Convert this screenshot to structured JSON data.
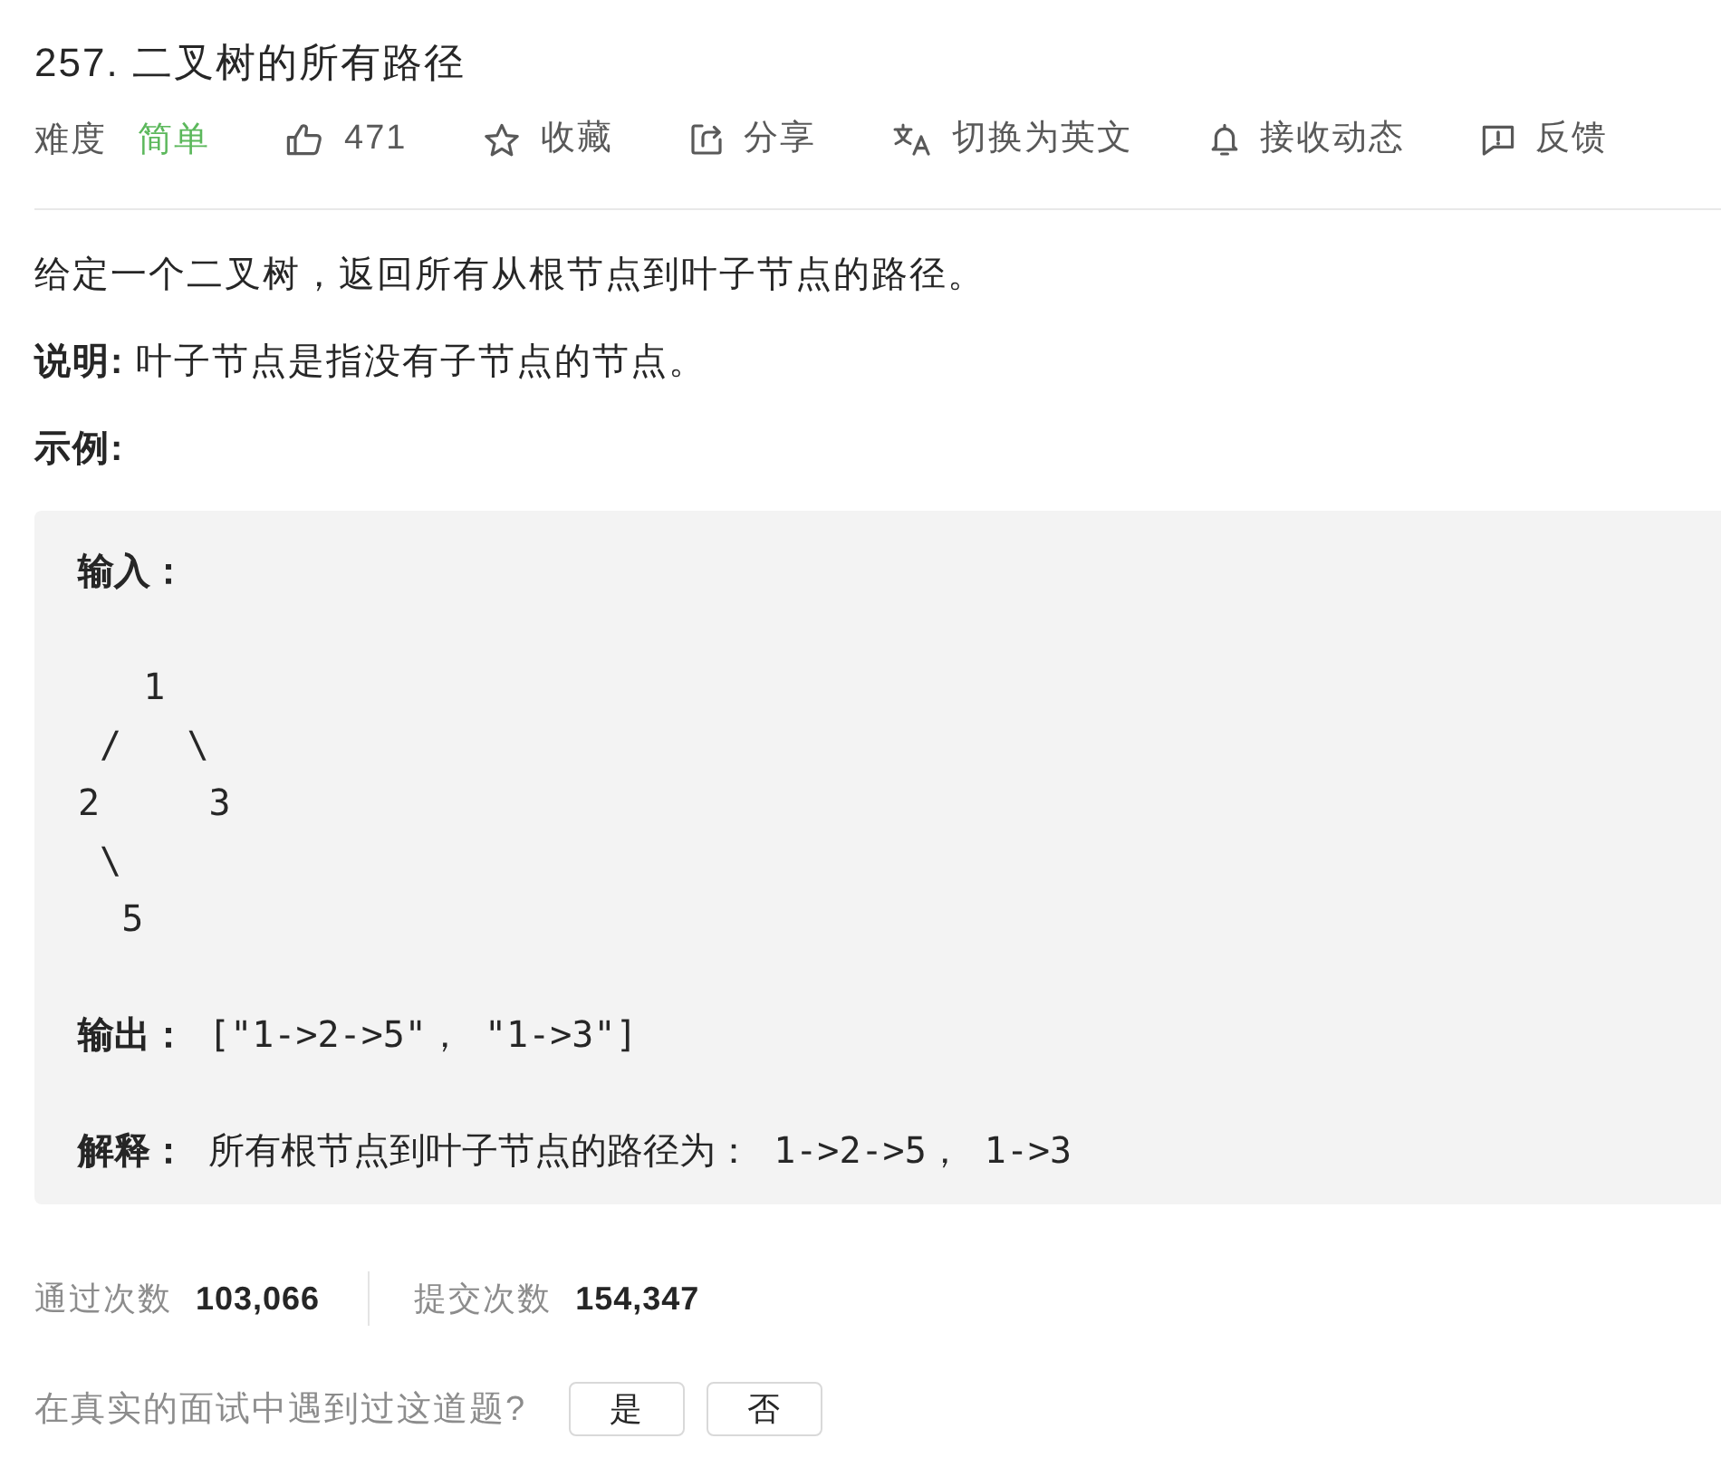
{
  "problem": {
    "title": "257. 二叉树的所有路径"
  },
  "toolbar": {
    "difficulty_label": "难度",
    "difficulty": "简单",
    "actions": [
      {
        "kind": "like",
        "label": "471"
      },
      {
        "kind": "favorite",
        "label": "收藏"
      },
      {
        "kind": "share",
        "label": "分享"
      },
      {
        "kind": "translate",
        "label": "切换为英文"
      },
      {
        "kind": "notify",
        "label": "接收动态"
      },
      {
        "kind": "feedback",
        "label": "反馈"
      }
    ]
  },
  "description": {
    "paragraphs": [
      "给定一个二叉树，返回所有从根节点到叶子节点的路径。",
      "**说明:** 叶子节点是指没有子节点的节点。"
    ],
    "example_heading": "示例:"
  },
  "example": {
    "input_label": "输入：",
    "tree": "   1\n /   \\\n2     3\n \\\n  5",
    "output": "**输出：** [\"1->2->5\"， \"1->3\"]",
    "explanation": "**解释：** 所有根节点到叶子节点的路径为： 1->2->5， 1->3"
  },
  "stats": [
    {
      "label": "通过次数",
      "value": "103,066"
    },
    {
      "label": "提交次数",
      "value": "154,347"
    }
  ],
  "interview": {
    "question": "在真实的面试中遇到过这道题?",
    "buttons": [
      "是",
      "否"
    ]
  }
}
